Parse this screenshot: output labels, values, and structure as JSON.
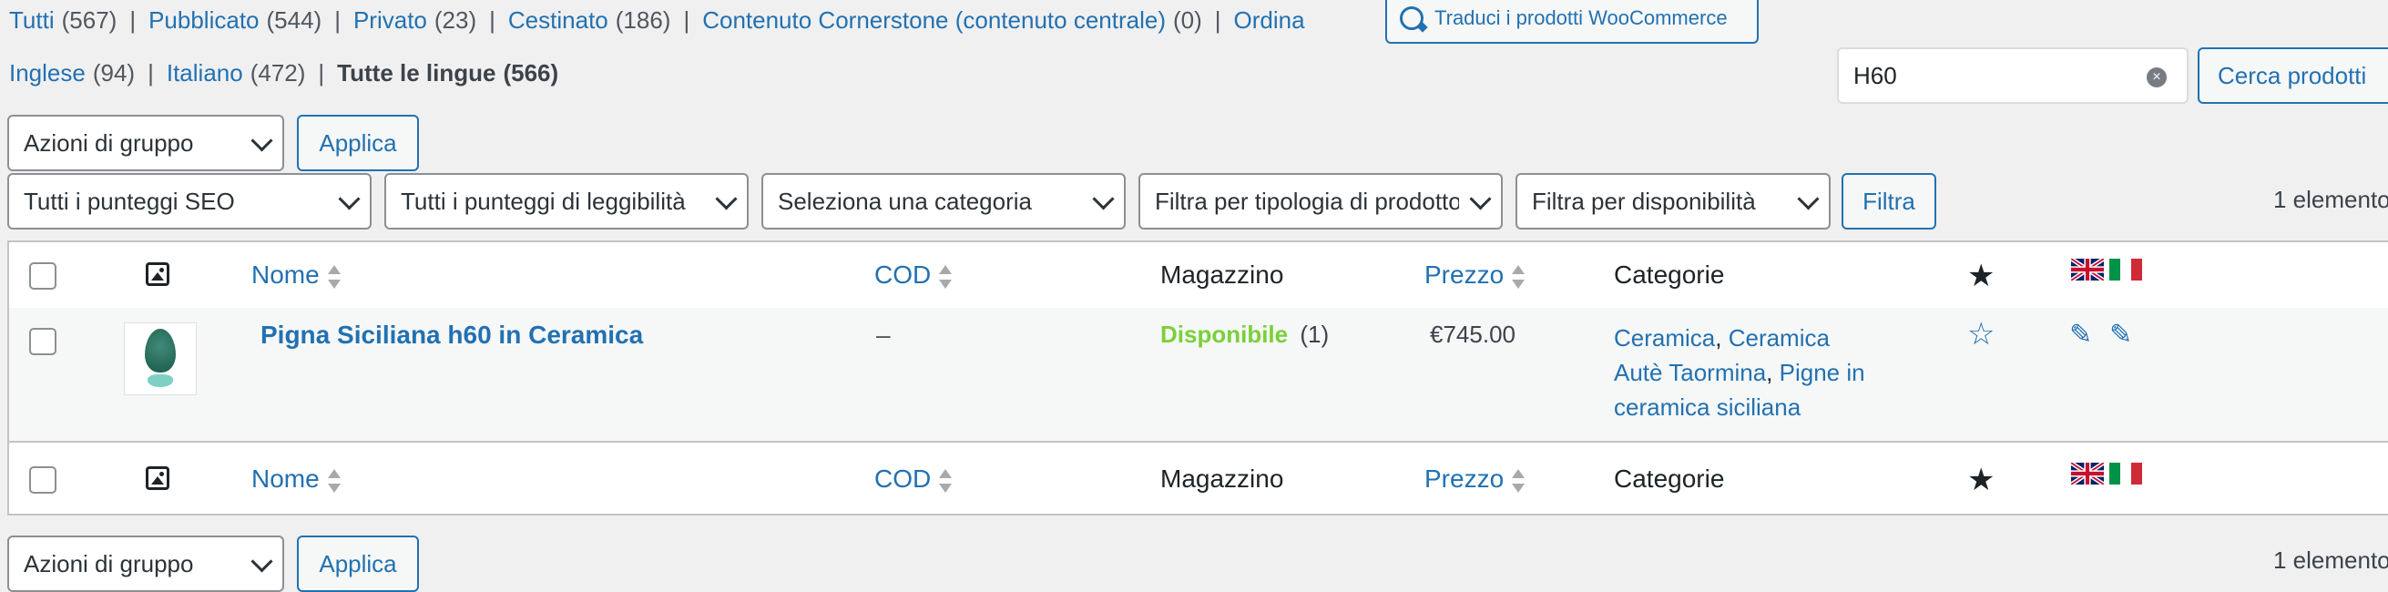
{
  "status_filters": [
    {
      "label": "Tutti",
      "count": "(567)"
    },
    {
      "label": "Pubblicato",
      "count": "(544)"
    },
    {
      "label": "Privato",
      "count": "(23)"
    },
    {
      "label": "Cestinato",
      "count": "(186)"
    },
    {
      "label": "Contenuto Cornerstone (contenuto centrale)",
      "count": "(0)"
    },
    {
      "label": "Ordina",
      "count": ""
    }
  ],
  "translate_button": "Traduci i prodotti WooCommerce",
  "language_filters": [
    {
      "label": "Inglese",
      "count": "(94)"
    },
    {
      "label": "Italiano",
      "count": "(472)"
    },
    {
      "label": "Tutte le lingue",
      "count": "(566)"
    }
  ],
  "search": {
    "value": "H60",
    "button": "Cerca prodotti"
  },
  "bulk_actions": {
    "select": "Azioni di gruppo",
    "apply": "Applica"
  },
  "filters": {
    "seo": "Tutti i punteggi SEO",
    "readability": "Tutti i punteggi di leggibilità",
    "category": "Seleziona una categoria",
    "product_type": "Filtra per tipologia di prodotto",
    "stock": "Filtra per disponibilità",
    "filter_button": "Filtra",
    "items_count": "1 elemento"
  },
  "table": {
    "columns": {
      "name": "Nome",
      "sku": "COD",
      "stock": "Magazzino",
      "price": "Prezzo",
      "categories": "Categorie"
    },
    "rows": [
      {
        "name": "Pigna Siciliana h60 in Ceramica",
        "sku": "–",
        "stock_status": "Disponibile",
        "stock_qty": "(1)",
        "price": "€745.00",
        "categories_line1a": "Ceramica",
        "categories_line1b": "Ceramica",
        "categories_line2a": "Autè Taormina",
        "categories_line2b": "Pigne in",
        "categories_line3": "ceramica siciliana"
      }
    ]
  },
  "colors": {
    "link": "#2271b1",
    "in_stock": "#7ad03a",
    "border": "#c3c4c7"
  },
  "icons": [
    "image-icon",
    "star-filled-icon",
    "star-outline-icon",
    "flag-uk-icon",
    "flag-italy-icon",
    "pencil-icon",
    "search-clear-icon",
    "translate-icon"
  ]
}
